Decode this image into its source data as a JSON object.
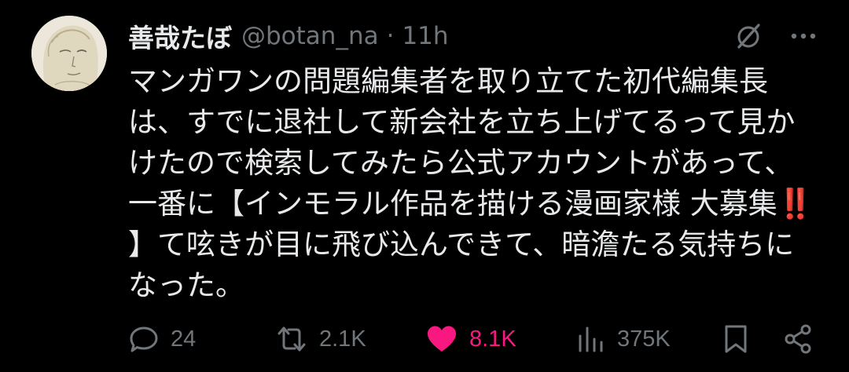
{
  "author": {
    "display_name": "善哉たぼ",
    "handle": "@botan_na",
    "separator": "·",
    "timestamp": "11h",
    "avatar_icon": "avatar-illustration"
  },
  "header_icons": [
    "grok-icon",
    "more-icon"
  ],
  "tweet": {
    "lines": [
      "マンガワンの問題編集者を取り立てた初代編集長",
      "は、すでに退社して新会社を立ち上げてるって見か",
      "けたので検索してみたら公式アカウントがあって、",
      "一番に【インモラル作品を描ける漫画家様 大募集‼️",
      "】て呟きが目に飛び込んできて、暗澹たる気持ちに",
      "なった。"
    ]
  },
  "actions": {
    "replies": "24",
    "reposts": "2.1K",
    "likes": "8.1K",
    "views": "375K"
  },
  "colors": {
    "background": "#000000",
    "text_primary": "#e7e9ea",
    "text_secondary": "#71767b",
    "like_active": "#f91880"
  }
}
